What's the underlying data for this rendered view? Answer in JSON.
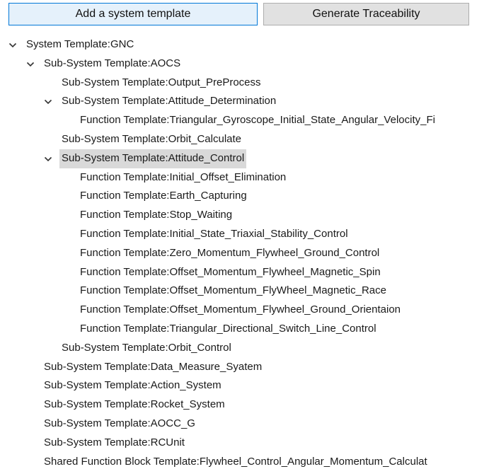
{
  "toolbar": {
    "add_label": "Add a system template",
    "generate_label": "Generate Traceability"
  },
  "tree": [
    {
      "label": "System Template:GNC",
      "level": 0,
      "expanded": true
    },
    {
      "label": "Sub-System Template:AOCS",
      "level": 1,
      "expanded": true
    },
    {
      "label": "Sub-System Template:Output_PreProcess",
      "level": 2
    },
    {
      "label": "Sub-System Template:Attitude_Determination",
      "level": 2,
      "expanded": true
    },
    {
      "label": "Function Template:Triangular_Gyroscope_Initial_State_Angular_Velocity_Fi",
      "level": 3
    },
    {
      "label": "Sub-System Template:Orbit_Calculate",
      "level": 2
    },
    {
      "label": "Sub-System Template:Attitude_Control",
      "level": 2,
      "expanded": true,
      "selected": true
    },
    {
      "label": "Function Template:Initial_Offset_Elimination",
      "level": 3
    },
    {
      "label": "Function Template:Earth_Capturing",
      "level": 3
    },
    {
      "label": "Function Template:Stop_Waiting",
      "level": 3
    },
    {
      "label": "Function Template:Initial_State_Triaxial_Stability_Control",
      "level": 3
    },
    {
      "label": "Function Template:Zero_Momentum_Flywheel_Ground_Control",
      "level": 3
    },
    {
      "label": "Function Template:Offset_Momentum_Flywheel_Magnetic_Spin",
      "level": 3
    },
    {
      "label": "Function Template:Offset_Momentum_FlyWheel_Magnetic_Race",
      "level": 3
    },
    {
      "label": "Function Template:Offset_Momentum_Flywheel_Ground_Orientaion",
      "level": 3
    },
    {
      "label": "Function Template:Triangular_Directional_Switch_Line_Control",
      "level": 3
    },
    {
      "label": "Sub-System Template:Orbit_Control",
      "level": 2
    },
    {
      "label": "Sub-System Template:Data_Measure_Syatem",
      "level": 1
    },
    {
      "label": "Sub-System Template:Action_System",
      "level": 1
    },
    {
      "label": "Sub-System Template:Rocket_System",
      "level": 1
    },
    {
      "label": "Sub-System Template:AOCC_G",
      "level": 1
    },
    {
      "label": "Sub-System Template:RCUnit",
      "level": 1
    },
    {
      "label": "Shared Function Block Template:Flywheel_Control_Angular_Momentum_Calculat",
      "level": 1
    }
  ],
  "icons": {
    "expanded": "chevron-down-icon"
  }
}
